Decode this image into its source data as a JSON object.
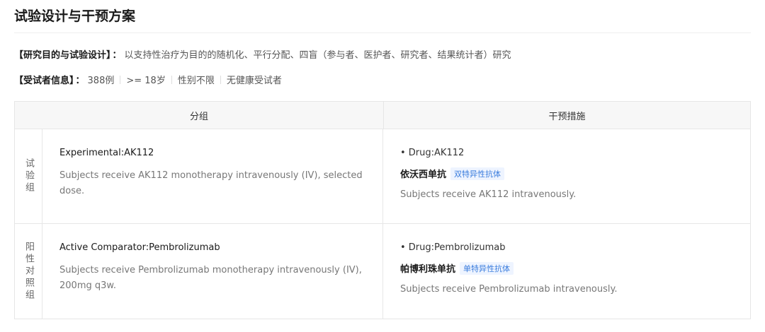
{
  "title": "试验设计与干预方案",
  "design": {
    "label": "【研究目的与试验设计】",
    "colon": "：",
    "text": "以支持性治疗为目的的随机化、平行分配、四盲（参与者、医护者、研究者、结果统计者）研究"
  },
  "subjects": {
    "label": "【受试者信息】",
    "colon": "：",
    "items": [
      "388例",
      ">= 18岁",
      "性别不限",
      "无健康受试者"
    ]
  },
  "table": {
    "headers": {
      "group": "分组",
      "intervention": "干预措施"
    },
    "rows": [
      {
        "row_label": "试验组",
        "arm_title": "Experimental:AK112",
        "arm_desc": "Subjects receive AK112 monotherapy intravenously (IV), selected dose.",
        "drug": "• Drug:AK112",
        "drug_cn": "依沃西单抗",
        "tag": "双特异性抗体",
        "drug_desc": "Subjects receive AK112 intravenously."
      },
      {
        "row_label": "阳性对照组",
        "arm_title": "Active Comparator:Pembrolizumab",
        "arm_desc": "Subjects receive Pembrolizumab monotherapy intravenously (IV), 200mg q3w.",
        "drug": "• Drug:Pembrolizumab",
        "drug_cn": "帕博利珠单抗",
        "tag": "单特异性抗体",
        "drug_desc": "Subjects receive Pembrolizumab intravenously."
      }
    ]
  }
}
